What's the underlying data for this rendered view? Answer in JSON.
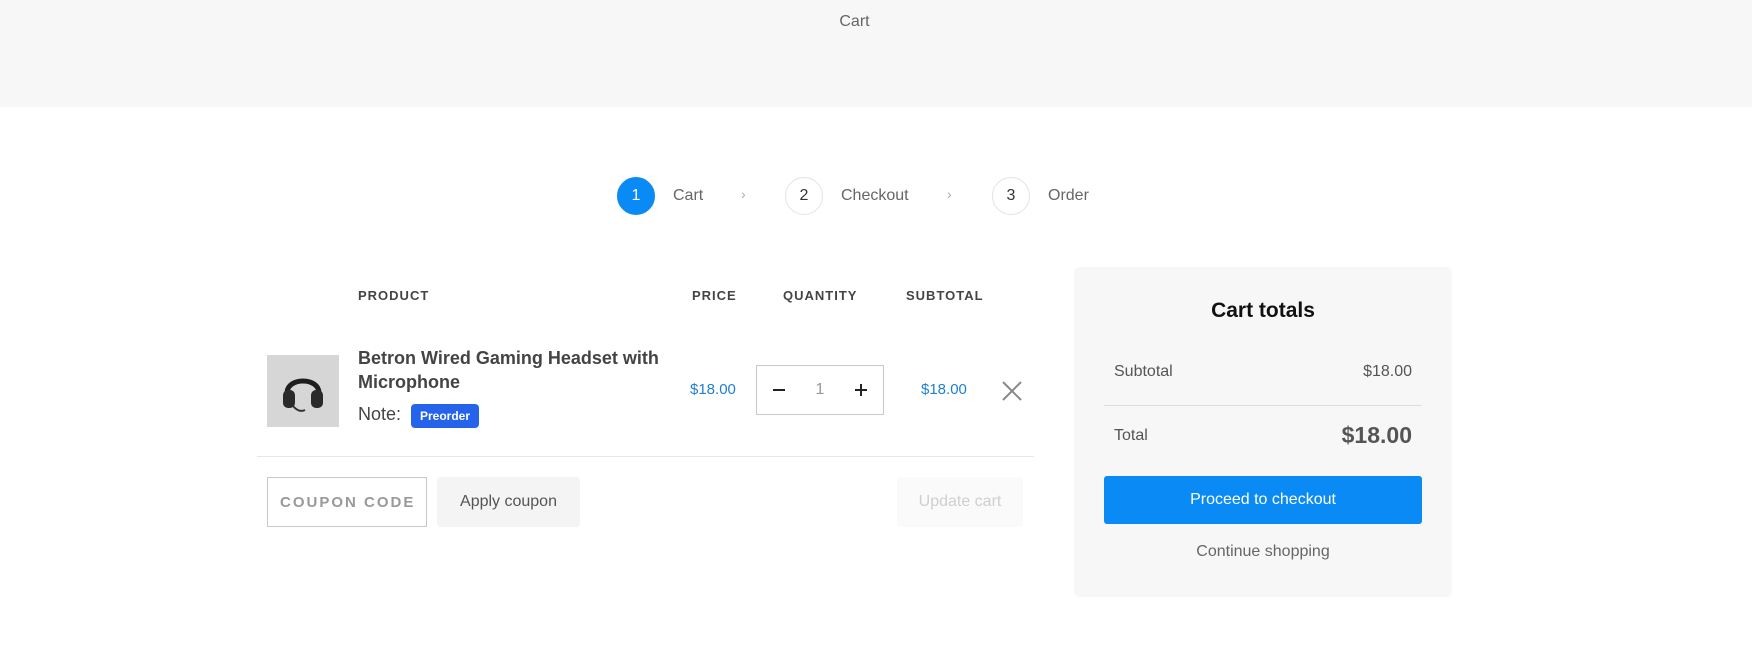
{
  "header": {
    "title": "Cart"
  },
  "steps": [
    {
      "number": "1",
      "label": "Cart",
      "active": true
    },
    {
      "number": "2",
      "label": "Checkout",
      "active": false
    },
    {
      "number": "3",
      "label": "Order",
      "active": false
    }
  ],
  "step_separator": "›",
  "table": {
    "headers": {
      "product": "PRODUCT",
      "price": "PRICE",
      "quantity": "QUANTITY",
      "subtotal": "SUBTOTAL"
    },
    "item": {
      "name": "Betron Wired Gaming Headset with Microphone",
      "note_label": "Note:",
      "badge": "Preorder",
      "price": "$18.00",
      "quantity": "1",
      "subtotal": "$18.00",
      "minus_icon": "minus-icon",
      "plus_icon": "plus-icon",
      "remove_icon": "close-icon"
    }
  },
  "coupon": {
    "placeholder": "COUPON CODE",
    "apply_label": "Apply coupon",
    "update_label": "Update cart"
  },
  "totals": {
    "heading": "Cart totals",
    "subtotal_label": "Subtotal",
    "subtotal_value": "$18.00",
    "total_label": "Total",
    "total_value": "$18.00",
    "checkout_label": "Proceed to checkout",
    "continue_label": "Continue shopping"
  },
  "colors": {
    "accent": "#0a8af5",
    "badge": "#2563eb",
    "price": "#1e7fd1"
  }
}
